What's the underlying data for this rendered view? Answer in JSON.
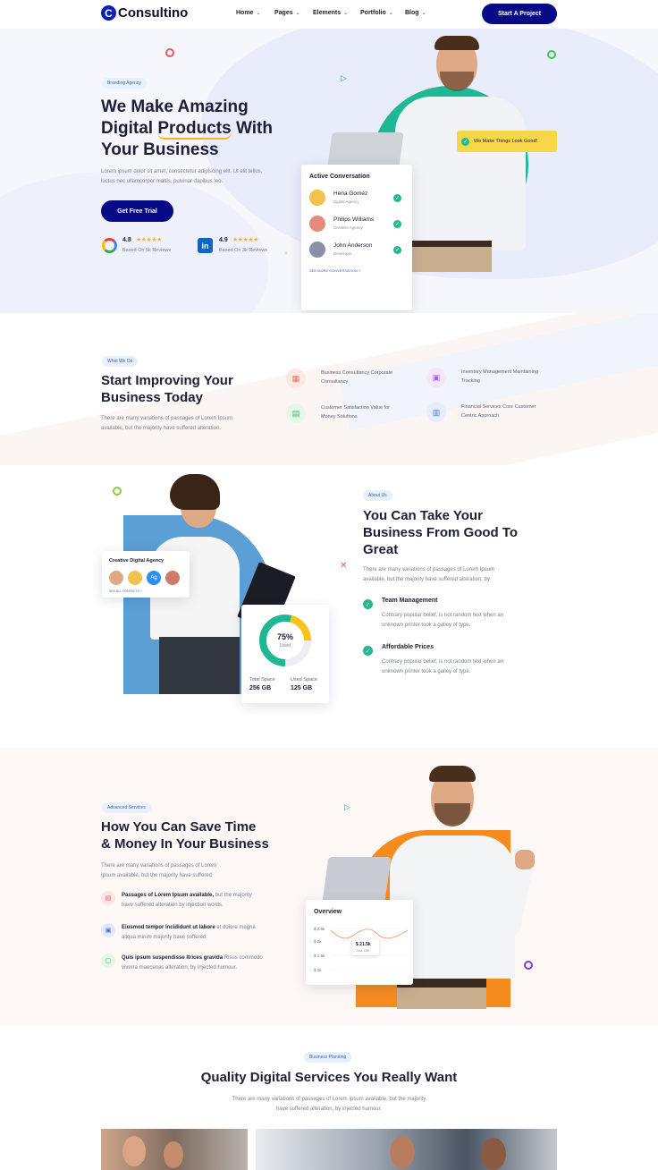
{
  "header": {
    "logo_letter": "C",
    "logo_text": "Consultino",
    "nav": [
      {
        "label": "Home"
      },
      {
        "label": "Pages"
      },
      {
        "label": "Elements"
      },
      {
        "label": "Portfolio"
      },
      {
        "label": "Blog"
      }
    ],
    "cta": "Start A Project"
  },
  "hero": {
    "pill": "Branding Agency",
    "title_line1": "We Make Amazing",
    "title_line2_a": "Digital ",
    "title_line2_b": "Products",
    "title_line2_c": " With",
    "title_line3": "Your Business",
    "desc_line1": "Lorem ipsum dolor sit amet, consectetur adipiscing elit. Ut elit tellus,",
    "desc_line2": "luctus nec ullamcorper mattis, pulvinar dapibus leo.",
    "button": "Get Free Trial",
    "ratings": [
      {
        "icon": "google-icon",
        "score": "4.8",
        "stars": "★★★★★",
        "label": "Based On 5k Reviews"
      },
      {
        "icon": "linkedin-icon",
        "score": "4.9",
        "stars": "★★★★★",
        "label": "Based On 3k Reviews"
      }
    ],
    "badge": "We Make Things Look Good!",
    "conversation": {
      "title": "Active Conversation",
      "people": [
        {
          "name": "Hena Gomez",
          "role": "Digital Agency"
        },
        {
          "name": "Philips Williams",
          "role": "Creative Agency"
        },
        {
          "name": "John Anderson",
          "role": "Developer"
        }
      ],
      "link": "SEE MORE CONVERSATION +"
    }
  },
  "improve": {
    "pill": "What We Do",
    "title_line1": "Start Improving Your",
    "title_line2": "Business Today",
    "desc_line1": "There are many variations of passages of Lorem Ipsum",
    "desc_line2": "available, but the majority have suffered alteration.",
    "features": [
      {
        "line1": "Business Consultancy Corporate",
        "line2": "Consultancy",
        "icon": "consultancy-icon"
      },
      {
        "line1": "Inventory Management Maintaining",
        "line2": "Tracking",
        "icon": "inventory-icon"
      },
      {
        "line1": "Customer Satisfaction Value for",
        "line2": "Money Solutions",
        "icon": "satisfaction-icon"
      },
      {
        "line1": "Financial Services Core Customer",
        "line2": "Centric Approach",
        "icon": "financial-icon"
      }
    ]
  },
  "about": {
    "pill": "About Us",
    "title_line1": "You Can Take Your",
    "title_line2": "Business From Good To",
    "title_line3": "Great",
    "desc_line1": "There are many variations of passages of Lorem Ipsum",
    "desc_line2": "available, but the majority have suffered alteration, by",
    "items": [
      {
        "title": "Team Management",
        "line1": "Contrary popular belief, is not random text when an",
        "line2": "unknown printer took a galley of type."
      },
      {
        "title": "Affordable Prices",
        "line1": "Contrary popular belief, is not random text when an",
        "line2": "unknown printer took a galley of type."
      }
    ],
    "agency_card": {
      "title": "Creative Digital Agency",
      "initials": "Ag",
      "link": "SEE ALL CONTACTS +"
    },
    "storage": {
      "percent": "75%",
      "percent_value": 75,
      "used_label": "Used",
      "total_label": "Total Space",
      "total_value": "256 GB",
      "used_space_label": "Used Space",
      "used_space_value": "125 GB"
    }
  },
  "services": {
    "pill": "Advanced Services",
    "title_line1": "How You Can Save Time",
    "title_line2": "& Money In Your Business",
    "desc_line1": "There are many variations of passages of Lorem",
    "desc_line2": "Ipsum available, but the majority have suffered",
    "items": [
      {
        "bold": "Passages of Lorem Ipsum available,",
        "rest": " but the majority",
        "line2": "have suffered alteration by injection words.",
        "icon": "calendar-icon"
      },
      {
        "bold": "Eiusmod tempor incididunt ut labore",
        "rest": " et dolore magna",
        "line2": "aliqua minim majority have suffered.",
        "icon": "briefcase-icon"
      },
      {
        "bold": "Quis ipsum suspendisse ltrices gravida",
        "rest": " Risus commodo",
        "line2": "viverra maecenas alteration, by injected humour.",
        "icon": "bookmark-icon"
      }
    ],
    "overview": {
      "title": "Overview",
      "yticks": [
        "$ 2.5k",
        "$ 2k",
        "$ 1.5k",
        "$ 1k"
      ],
      "tooltip_value": "$ 21.5k",
      "tooltip_date": "June 15th"
    }
  },
  "quality": {
    "pill": "Business Planning",
    "title": "Quality Digital Services You Really Want",
    "desc_line1": "There are many variations of passages of Lorem Ipsum available, but the majority",
    "desc_line2": "have suffered alteration, by injected humour."
  }
}
